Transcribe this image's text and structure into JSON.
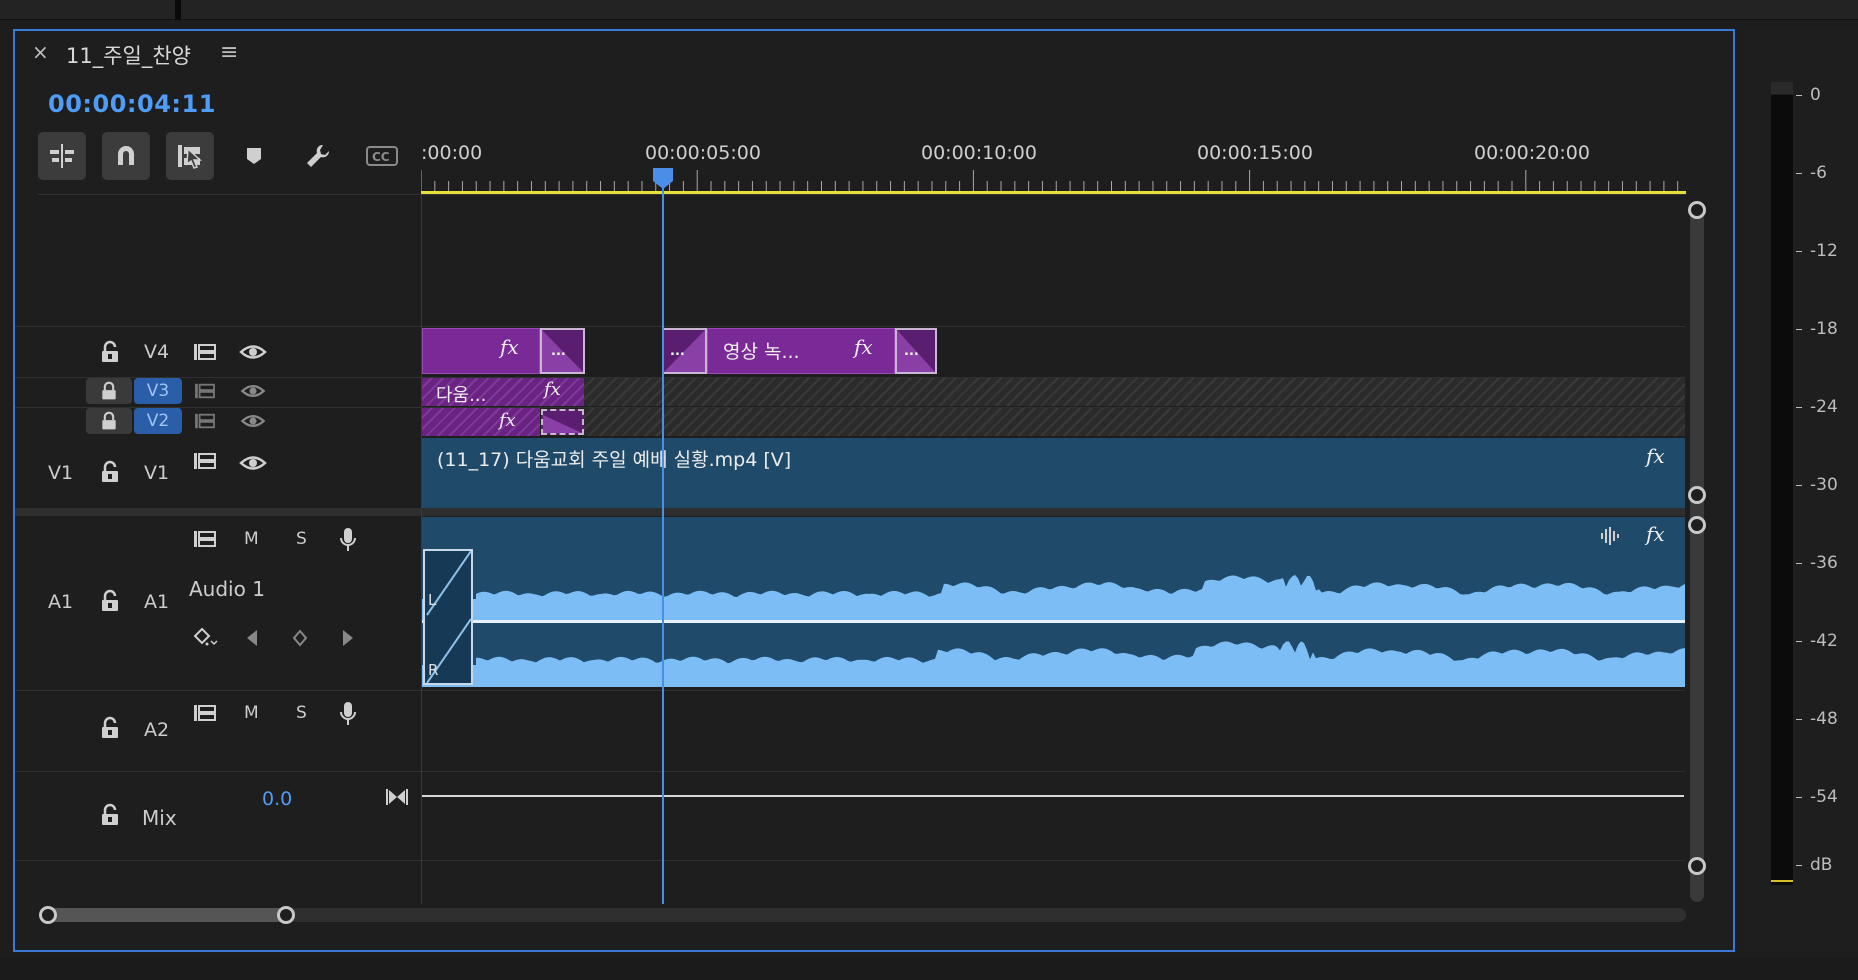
{
  "sequence": {
    "title": "11_주일_찬양",
    "timecode": "00:00:04:11"
  },
  "toolbar": {
    "tools": [
      "insert-snap",
      "snap-magnet",
      "linked-selection",
      "add-marker",
      "settings",
      "captions"
    ]
  },
  "ruler": {
    "labels": [
      ":00:00",
      "00:00:05:00",
      "00:00:10:00",
      "00:00:15:00",
      "00:00:20:00"
    ]
  },
  "tracks": {
    "v4": {
      "name": "V4"
    },
    "v3": {
      "name": "V3"
    },
    "v2": {
      "name": "V2"
    },
    "v1": {
      "source": "V1",
      "name": "V1"
    },
    "a1": {
      "source": "A1",
      "name": "A1",
      "label": "Audio 1",
      "m": "M",
      "s": "S"
    },
    "a2": {
      "name": "A2",
      "m": "M",
      "s": "S"
    },
    "mix": {
      "name": "Mix",
      "value": "0.0"
    }
  },
  "clips": {
    "v4_clip2_label": "영상 녹...",
    "v3_clip_label": "다움...",
    "v1_clip_label": "(11_17) 다움교회 주일 예배 실황.mp4 [V]",
    "fx": "fx",
    "trans": "...",
    "left_channel": "L",
    "right_channel": "R"
  },
  "meter": {
    "labels": [
      "0",
      "-6",
      "-12",
      "-18",
      "-24",
      "-30",
      "-36",
      "-42",
      "-48",
      "-54",
      "dB"
    ]
  },
  "colors": {
    "accent": "#4f9cf6",
    "clip_video": "#7a2a96",
    "clip_blue": "#1f4a69",
    "waveform": "#7cbdf5",
    "ruler_work_area": "#e6e03a"
  }
}
